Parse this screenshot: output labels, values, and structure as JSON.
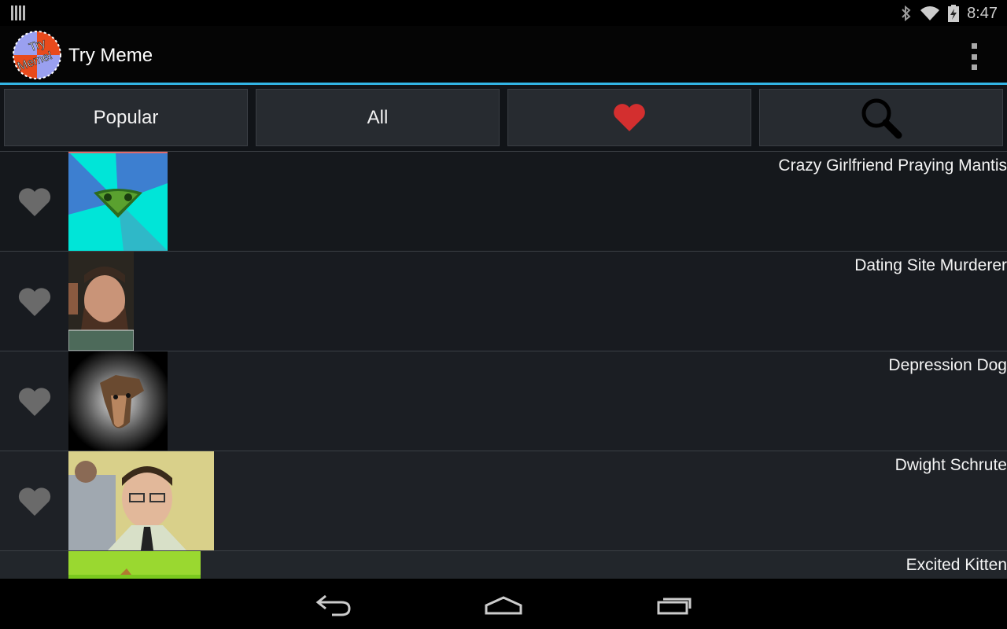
{
  "status_bar": {
    "time": "8:47",
    "icons": [
      "notification-bars-icon",
      "bluetooth-icon",
      "wifi-icon",
      "battery-charging-icon"
    ]
  },
  "action_bar": {
    "title": "Try Meme",
    "logo_text": "Try Meme!",
    "overflow_icon": "overflow-menu-icon"
  },
  "tabs": [
    {
      "label": "Popular"
    },
    {
      "label": "All"
    },
    {
      "label": "",
      "icon": "heart-icon",
      "color": "#d32f2f"
    },
    {
      "label": "",
      "icon": "search-icon"
    }
  ],
  "memes": [
    {
      "title": "Crazy Girlfriend Praying Mantis",
      "favorite": false
    },
    {
      "title": "Dating Site Murderer",
      "favorite": false
    },
    {
      "title": "Depression Dog",
      "favorite": false
    },
    {
      "title": "Dwight Schrute",
      "favorite": false
    },
    {
      "title": "Excited Kitten",
      "favorite": false
    }
  ],
  "nav_bar": {
    "buttons": [
      "back-icon",
      "home-icon",
      "recents-icon"
    ]
  },
  "colors": {
    "accent": "#33b5e5",
    "favorite_inactive": "#6a6a6a",
    "favorite_active": "#d32f2f"
  }
}
